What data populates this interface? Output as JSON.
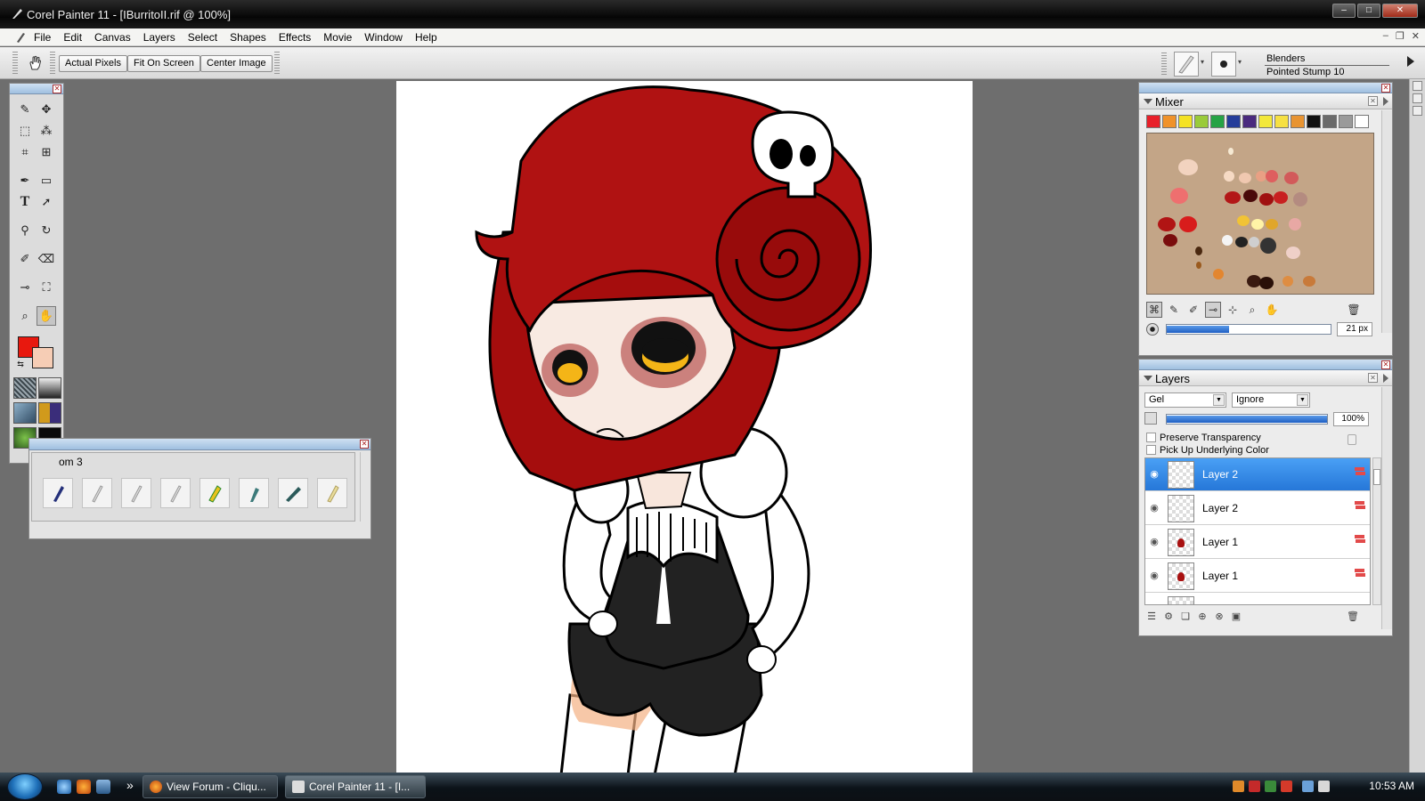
{
  "window": {
    "title": "Corel Painter 11 - [IBurritoII.rif @ 100%]"
  },
  "menu": [
    "File",
    "Edit",
    "Canvas",
    "Layers",
    "Select",
    "Shapes",
    "Effects",
    "Movie",
    "Window",
    "Help"
  ],
  "propbar": {
    "actual_pixels": "Actual Pixels",
    "fit_on_screen": "Fit On Screen",
    "center_image": "Center Image",
    "brush_category": "Blenders",
    "brush_variant": "Pointed Stump 10"
  },
  "colors": {
    "main_color": "#e8180e",
    "additional_color": "#f6cdb5",
    "accent_blue": "#2677d8"
  },
  "brush_palette": {
    "title": "om  3",
    "brush_icons": [
      "pen-icon",
      "pencil-icon",
      "pencil-icon",
      "pencil-icon",
      "marker-icon",
      "nib-icon",
      "airbrush-icon",
      "blender-icon"
    ]
  },
  "mixer": {
    "title": "Mixer",
    "swatches": [
      "#e8202a",
      "#f0922a",
      "#f4e224",
      "#9acb3a",
      "#26a345",
      "#253d9a",
      "#4a2a7e",
      "#f3e83a",
      "#f6e043",
      "#e89432",
      "#111111",
      "#6a6a6a",
      "#9a9a9a",
      "#ffffff"
    ],
    "brush_size": "21 px"
  },
  "layers": {
    "title": "Layers",
    "composite_method": "Gel",
    "composite_depth": "Ignore",
    "opacity": "100%",
    "preserve_transparency": "Preserve Transparency",
    "pick_up_underlying": "Pick Up Underlying Color",
    "items": [
      {
        "name": "Layer 2"
      },
      {
        "name": "Layer 2"
      },
      {
        "name": "Layer 1"
      },
      {
        "name": "Layer 1"
      }
    ]
  },
  "taskbar": {
    "tasks": [
      {
        "label": "View Forum - Cliqu..."
      },
      {
        "label": "Corel Painter 11 - [I..."
      }
    ],
    "more": "»",
    "clock": "10:53 AM"
  }
}
